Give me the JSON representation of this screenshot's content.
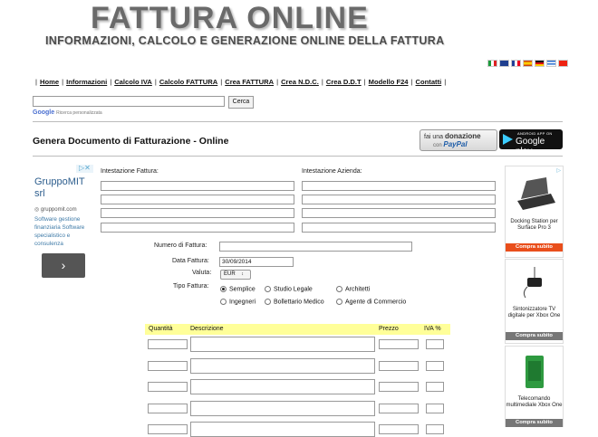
{
  "header": {
    "logo_text": "FATTURA ONLINE",
    "tagline": "INFORMAZIONI, CALCOLO E GENERAZIONE ONLINE DELLA FATTURA"
  },
  "flags": [
    "flag-italy",
    "flag-uk",
    "flag-france",
    "flag-spain",
    "flag-germany",
    "flag-greece",
    "flag-turkey"
  ],
  "nav": {
    "items": [
      "Home",
      "Informazioni",
      "Calcolo IVA",
      "Calcolo FATTURA",
      "Crea FATTURA",
      "Crea N.D.C.",
      "Crea D.D.T",
      "Modello F24",
      "Contatti"
    ]
  },
  "search": {
    "button_label": "Cerca",
    "google_label": "Google",
    "google_suffix": "Ricerca personalizzata"
  },
  "page": {
    "title": "Genera Documento di Fatturazione - Online"
  },
  "donate": {
    "line1_prefix": "fai una",
    "line1_bold": "donazione",
    "line2_prefix": "con",
    "paypal": "PayPal"
  },
  "google_play": {
    "small": "ANDROID APP ON",
    "big": "Google play"
  },
  "left_ad": {
    "title": "GruppoMIT srl",
    "url": "gruppomit.com",
    "description": "Software gestione finanziaria Software specialistico e consulenza",
    "arrow": "›"
  },
  "form": {
    "intestazione_fattura_label": "Intestazione Fattura:",
    "intestazione_azienda_label": "Intestazione Azienda:",
    "numero_label": "Numero di Fattura:",
    "numero_value": "",
    "data_label": "Data Fattura:",
    "data_value": "30/09/2014",
    "valuta_label": "Valuta:",
    "valuta_value": "EUR",
    "tipo_label": "Tipo Fattura:",
    "tipo_options": [
      "Semplice",
      "Studio Legale",
      "Architetti",
      "Ingegneri",
      "Bollettario Medico",
      "Agente di Commercio"
    ],
    "tipo_selected": "Semplice"
  },
  "table": {
    "headers": {
      "quantita": "Quantità",
      "descrizione": "Descrizione",
      "prezzo": "Prezzo",
      "iva": "IVA %"
    }
  },
  "right_ads": [
    {
      "title": "Docking Station per Surface Pro 3",
      "button": "Compra subito"
    },
    {
      "title": "Sintonizzatore TV digitale per Xbox One",
      "button": "Compra subito"
    },
    {
      "title": "Telecomando multimediale Xbox One",
      "button": "Compra subito"
    }
  ]
}
